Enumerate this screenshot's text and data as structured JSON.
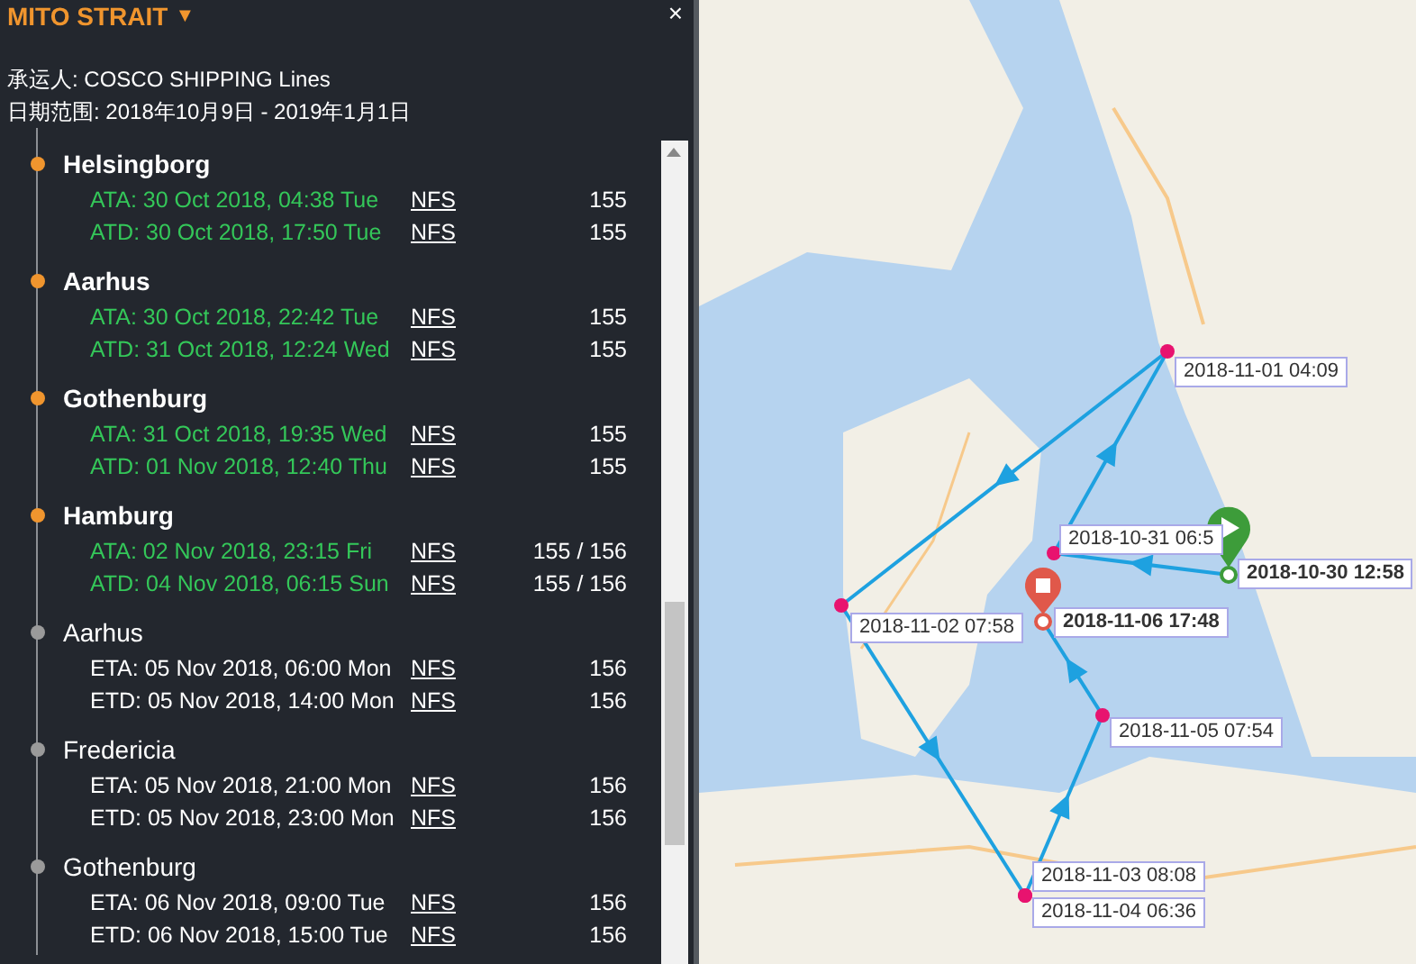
{
  "panel": {
    "title": "MITO STRAIT",
    "caret": "▼",
    "close": "×",
    "carrier": "承运人: COSCO SHIPPING Lines",
    "date_range": "日期范围: 2018年10月9日 - 2019年1月1日"
  },
  "stops": [
    {
      "name": "Helsingborg",
      "completed": true,
      "events": [
        {
          "label": "ATA: 30 Oct 2018, 04:38 Tue",
          "link": "NFS",
          "value": "155"
        },
        {
          "label": "ATD: 30 Oct 2018, 17:50 Tue",
          "link": "NFS",
          "value": "155"
        }
      ]
    },
    {
      "name": "Aarhus",
      "completed": true,
      "events": [
        {
          "label": "ATA: 30 Oct 2018, 22:42 Tue",
          "link": "NFS",
          "value": "155"
        },
        {
          "label": "ATD: 31 Oct 2018, 12:24 Wed",
          "link": "NFS",
          "value": "155"
        }
      ]
    },
    {
      "name": "Gothenburg",
      "completed": true,
      "events": [
        {
          "label": "ATA: 31 Oct 2018, 19:35 Wed",
          "link": "NFS",
          "value": "155"
        },
        {
          "label": "ATD: 01 Nov 2018, 12:40 Thu",
          "link": "NFS",
          "value": "155"
        }
      ]
    },
    {
      "name": "Hamburg",
      "completed": true,
      "events": [
        {
          "label": "ATA: 02 Nov 2018, 23:15 Fri",
          "link": "NFS",
          "value": "155 / 156"
        },
        {
          "label": "ATD: 04 Nov 2018, 06:15 Sun",
          "link": "NFS",
          "value": "155 / 156"
        }
      ]
    },
    {
      "name": "Aarhus",
      "completed": false,
      "events": [
        {
          "label": "ETA: 05 Nov 2018, 06:00 Mon",
          "link": "NFS",
          "value": "156"
        },
        {
          "label": "ETD: 05 Nov 2018, 14:00 Mon",
          "link": "NFS",
          "value": "156"
        }
      ]
    },
    {
      "name": "Fredericia",
      "completed": false,
      "events": [
        {
          "label": "ETA: 05 Nov 2018, 21:00 Mon",
          "link": "NFS",
          "value": "156"
        },
        {
          "label": "ETD: 05 Nov 2018, 23:00 Mon",
          "link": "NFS",
          "value": "156"
        }
      ]
    },
    {
      "name": "Gothenburg",
      "completed": false,
      "events": [
        {
          "label": "ETA: 06 Nov 2018, 09:00 Tue",
          "link": "NFS",
          "value": "156"
        },
        {
          "label": "ETD: 06 Nov 2018, 15:00 Tue",
          "link": "NFS",
          "value": "156"
        }
      ]
    }
  ],
  "map": {
    "kind": "picture",
    "route": [
      {
        "kind": "start",
        "label": "2018-10-30 12:58"
      },
      {
        "kind": "point",
        "label": "2018-10-31 06:5"
      },
      {
        "kind": "point",
        "label": "2018-11-01 04:09"
      },
      {
        "kind": "point",
        "label": "2018-11-02 07:58"
      },
      {
        "kind": "point",
        "label": "2018-11-03 08:08"
      },
      {
        "kind": "point",
        "label": "2018-11-04 06:36"
      },
      {
        "kind": "point",
        "label": "2018-11-05 07:54"
      },
      {
        "kind": "end",
        "label": "2018-11-06 17:48"
      }
    ]
  }
}
